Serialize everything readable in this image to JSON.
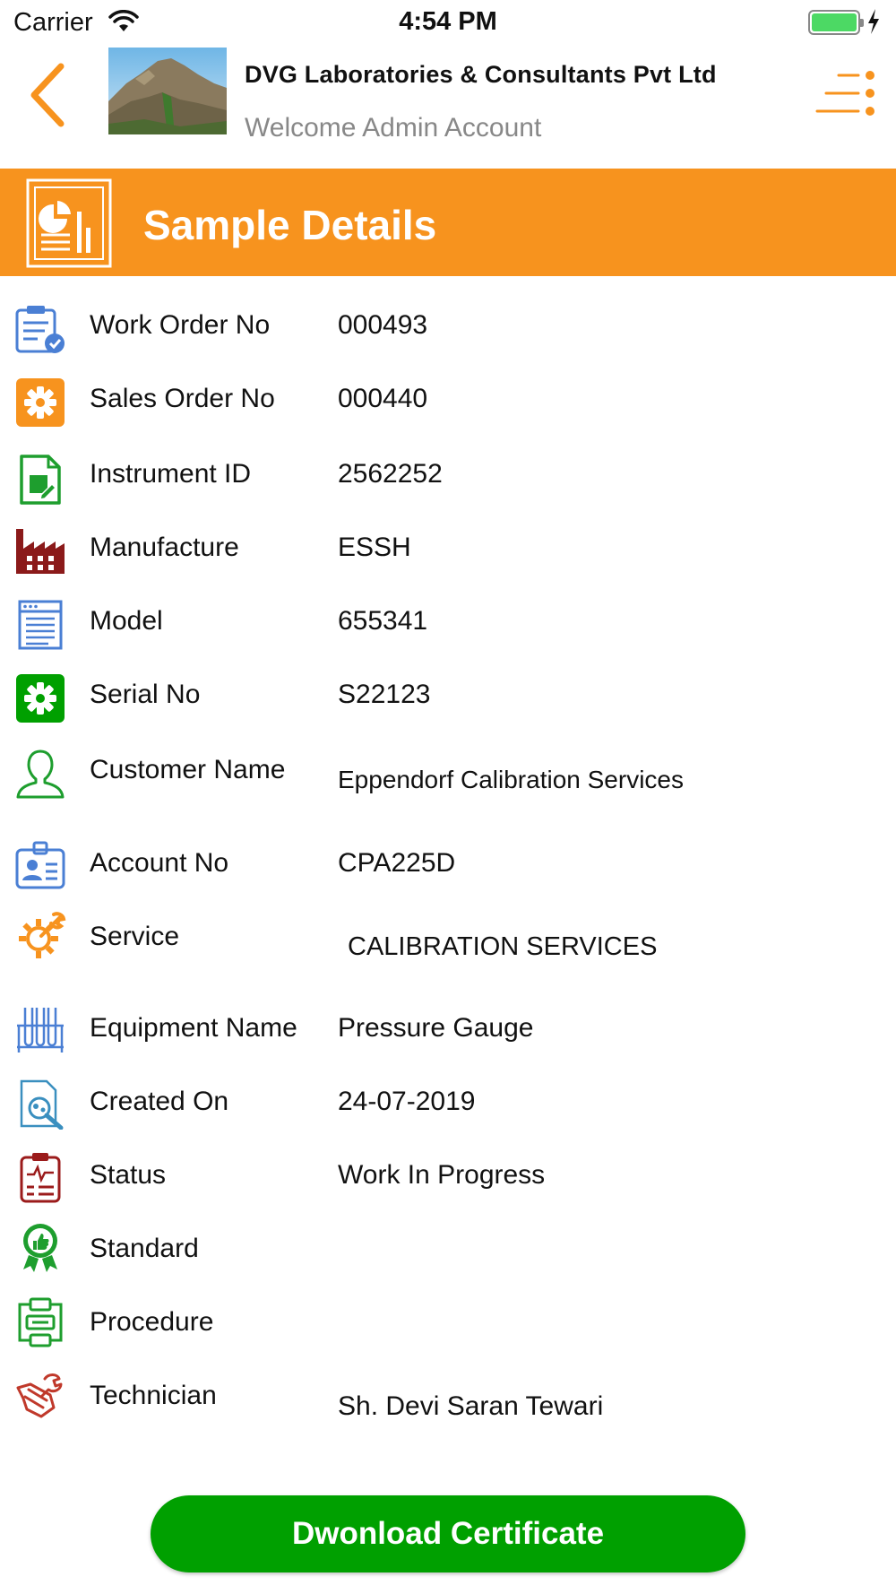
{
  "status_bar": {
    "carrier": "Carrier",
    "time": "4:54 PM"
  },
  "header": {
    "company_name": "DVG Laboratories & Consultants Pvt Ltd",
    "welcome": "Welcome Admin Account"
  },
  "banner": {
    "title": "Sample Details"
  },
  "details": [
    {
      "label": "Work Order No",
      "value": "000493",
      "icon": "work-order-icon"
    },
    {
      "label": "Sales Order No",
      "value": "000440",
      "icon": "sales-order-gear-icon"
    },
    {
      "label": "Instrument ID",
      "value": "2562252",
      "icon": "instrument-document-icon"
    },
    {
      "label": "Manufacture",
      "value": "ESSH",
      "icon": "factory-icon"
    },
    {
      "label": "Model",
      "value": "655341",
      "icon": "model-document-icon"
    },
    {
      "label": "Serial No",
      "value": "S22123",
      "icon": "serial-gear-icon"
    },
    {
      "label": "Customer Name",
      "value": "Eppendorf Calibration Services",
      "icon": "customer-person-icon"
    },
    {
      "label": "Account No",
      "value": "CPA225D",
      "icon": "account-id-card-icon"
    },
    {
      "label": "Service",
      "value": "CALIBRATION SERVICES",
      "icon": "service-wrench-gear-icon"
    },
    {
      "label": "Equipment Name",
      "value": "Pressure Gauge",
      "icon": "test-tubes-icon"
    },
    {
      "label": "Created On",
      "value": "24-07-2019",
      "icon": "search-document-icon"
    },
    {
      "label": "Status",
      "value": "Work In Progress",
      "icon": "clipboard-icon"
    },
    {
      "label": "Standard",
      "value": "",
      "icon": "thumbs-up-badge-icon"
    },
    {
      "label": "Procedure",
      "value": "",
      "icon": "procedure-flow-icon"
    },
    {
      "label": "Technician",
      "value": "Sh. Devi Saran Tewari",
      "icon": "technician-wrench-icon"
    }
  ],
  "download_button": {
    "label": "Dwonload Certificate"
  },
  "colors": {
    "accent_orange": "#f7931e",
    "button_green": "#00a000",
    "battery_green": "#4cd964",
    "subtitle_gray": "#888888"
  }
}
